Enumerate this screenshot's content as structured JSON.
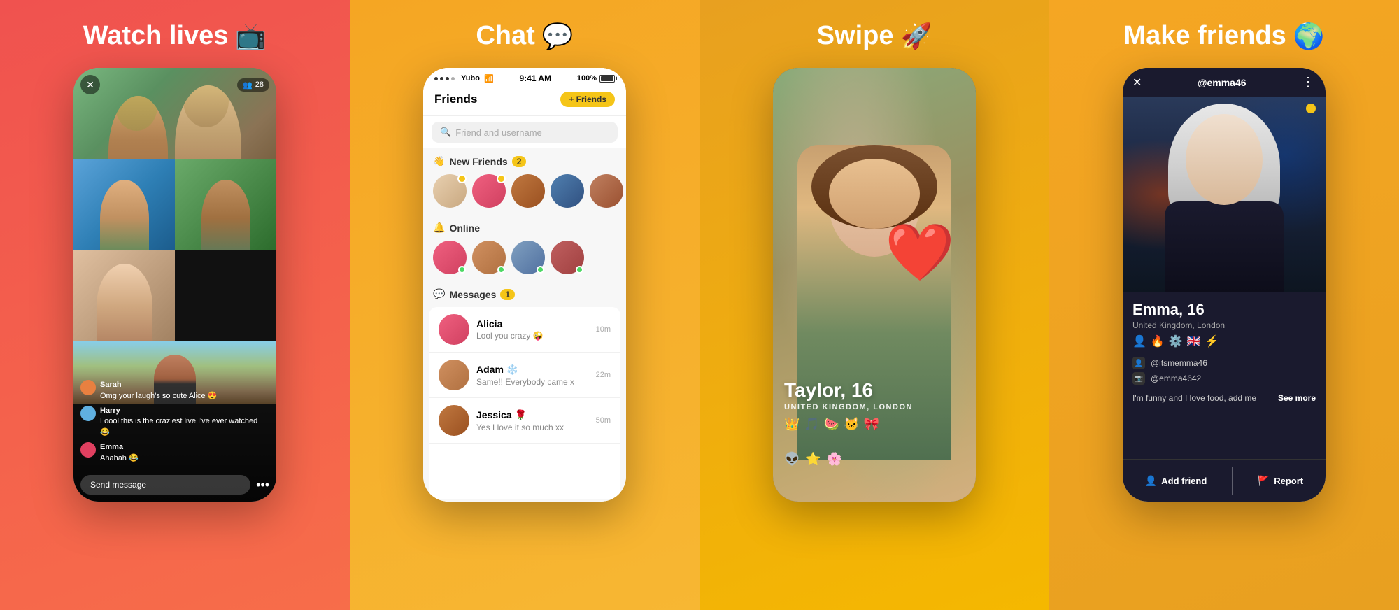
{
  "panels": [
    {
      "id": "watch-lives",
      "title": "Watch lives",
      "title_emoji": "📺",
      "bg_class": "panel-1",
      "viewers": "28",
      "chat_messages": [
        {
          "name": "Sarah",
          "text": "Omg your laugh's so cute Alice 😍",
          "av_class": "av1"
        },
        {
          "name": "Harry",
          "text": "Loool this is the craziest live I've ever watched 😂",
          "av_class": "av2"
        },
        {
          "name": "Emma",
          "text": "Ahahah 😂",
          "av_class": "av3"
        }
      ],
      "send_placeholder": "Send message"
    },
    {
      "id": "chat",
      "title": "Chat",
      "title_emoji": "💬",
      "bg_class": "panel-2",
      "status_bar": {
        "carrier": "Yubo",
        "wifi": "WiFi",
        "time": "9:41 AM",
        "battery": "100%"
      },
      "header": {
        "title": "Friends",
        "add_btn": "+ Friends"
      },
      "search_placeholder": "Friend and username",
      "sections": {
        "new_friends": {
          "label": "New Friends",
          "badge": "2",
          "emoji": "👋"
        },
        "online": {
          "label": "Online",
          "emoji": "🔔"
        },
        "messages": {
          "label": "Messages",
          "badge": "1",
          "emoji": "💬"
        }
      },
      "messages": [
        {
          "name": "Alicia",
          "preview": "Lool you crazy 🤪",
          "time": "10m",
          "av_class": "av-c2"
        },
        {
          "name": "Adam",
          "emoji": "❄️",
          "preview": "Same!! Everybody came x",
          "time": "22m",
          "av_class": "av-c6"
        },
        {
          "name": "Jessica",
          "emoji": "🌹",
          "preview": "Yes I love it so much xx",
          "time": "50m",
          "av_class": "av-c3"
        }
      ]
    },
    {
      "id": "swipe",
      "title": "Swipe",
      "title_emoji": "🚀",
      "bg_class": "panel-3",
      "profile": {
        "name": "Taylor, 16",
        "location": "UNITED KINGDOM, London",
        "emojis": [
          "👑",
          "🎵",
          "🍉",
          "🐱",
          "🎀"
        ],
        "bottom_emojis": [
          "👽",
          "⭐",
          "🌸"
        ]
      }
    },
    {
      "id": "make-friends",
      "title": "Make friends",
      "title_emoji": "🌍",
      "bg_class": "panel-4",
      "profile": {
        "username": "@emma46",
        "name": "Emma, 16",
        "location": "United Kingdom, London",
        "interest_emojis": [
          "👤",
          "🔥",
          "⚙️",
          "🇬🇧",
          "⚡"
        ],
        "links": [
          {
            "icon": "👤",
            "handle": "@itsmemma46"
          },
          {
            "icon": "📷",
            "handle": "@emma4642"
          }
        ],
        "bio": "I'm funny and I love food, add me",
        "actions": [
          {
            "icon": "👤+",
            "label": "Add friend"
          },
          {
            "icon": "🚩",
            "label": "Report"
          }
        ]
      }
    }
  ]
}
